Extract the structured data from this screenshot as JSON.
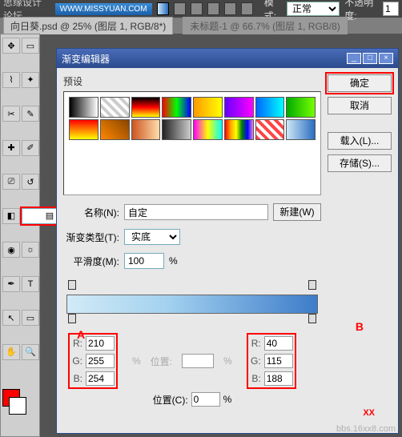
{
  "topbar": {
    "site_label": "思缘设计论坛",
    "watermark": "WWW.MISSYUAN.COM",
    "mode_label": "模式:",
    "mode_value": "正常",
    "opacity_label": "不透明度:",
    "opacity_value": "1"
  },
  "tabs": [
    {
      "label": "向日葵.psd @ 25% (图层 1, RGB/8*)"
    },
    {
      "label": "未标题-1 @ 66.7% (图层 1, RGB/8)"
    }
  ],
  "tools": {
    "icons": [
      "move",
      "rect-select",
      "lasso",
      "wand",
      "crop",
      "eyedrop",
      "heal",
      "brush",
      "stamp",
      "history",
      "eraser",
      "gradient",
      "blur",
      "dodge",
      "pen",
      "type",
      "path",
      "shape",
      "hand",
      "zoom"
    ]
  },
  "dialog": {
    "title": "渐变编辑器",
    "presets_label": "预设",
    "buttons": {
      "ok": "确定",
      "cancel": "取消",
      "load": "载入(L)...",
      "save": "存储(S)...",
      "new": "新建(W)"
    },
    "name_label": "名称(N):",
    "name_value": "自定",
    "type_label": "渐变类型(T):",
    "type_value": "实底",
    "smooth_label": "平滑度(M):",
    "smooth_value": "100",
    "pct": "%",
    "hue_label": "%",
    "pos_label": "位置:",
    "posC_label": "位置(C):",
    "posC_value": "0",
    "rgbA": {
      "R": "210",
      "G": "255",
      "B": "254"
    },
    "rgbB": {
      "R": "40",
      "G": "115",
      "B": "188"
    },
    "ann": {
      "A": "A",
      "B": "B",
      "XX": "XX"
    },
    "presets": [
      "linear-gradient(90deg,#000,#fff)",
      "repeating-linear-gradient(45deg,#ccc 0 4px,#fff 4px 8px)",
      "linear-gradient(#000,#f00,#ff0)",
      "linear-gradient(90deg,#f00,#0f0,#00f)",
      "linear-gradient(90deg,#f90,#ff0)",
      "linear-gradient(90deg,#60f,#f0f)",
      "linear-gradient(90deg,#06f,#0ff)",
      "linear-gradient(90deg,#0a0,#7f0)",
      "linear-gradient(#f00,#ff0)",
      "linear-gradient(45deg,#f80,#840)",
      "linear-gradient(90deg,#c52,#fda)",
      "linear-gradient(90deg,#222,#ccc)",
      "linear-gradient(90deg,#f0f,#ff0,#0ff)",
      "linear-gradient(90deg,red,orange,yellow,green,blue,violet)",
      "repeating-linear-gradient(45deg,#f44 0 4px,#fff 4px 8px)",
      "linear-gradient(90deg,#cde8f7,#2a6dc0)"
    ]
  },
  "footer_wm": "bbs.16xx8.com"
}
